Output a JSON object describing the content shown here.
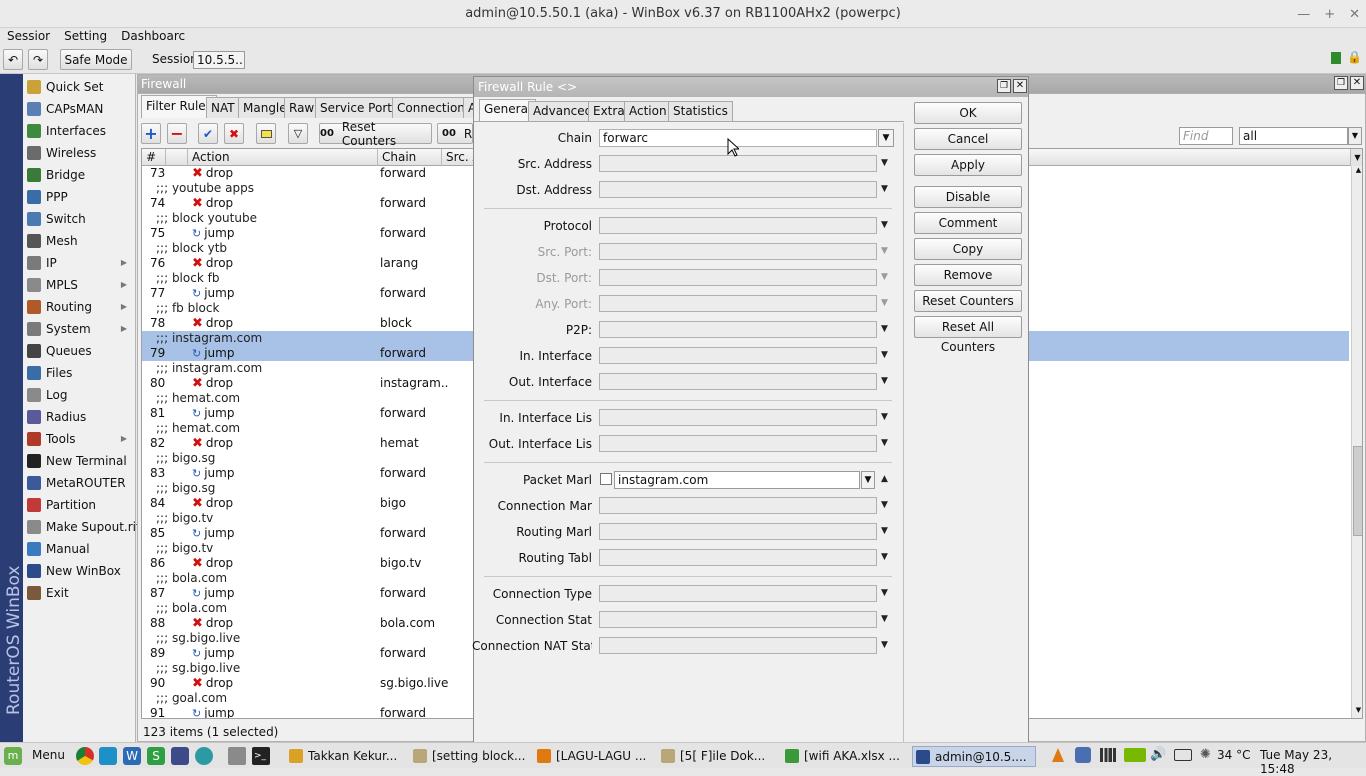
{
  "window": {
    "title": "admin@10.5.50.1 (aka) - WinBox v6.37 on RB1100AHx2 (powerpc)"
  },
  "menubar": {
    "items": [
      "Sessior",
      "Setting",
      "Dashboarc"
    ]
  },
  "toolbar": {
    "safe_mode": "Safe Mode",
    "session_label": "Session",
    "session_value": "10.5.5..."
  },
  "sidebar": {
    "vertical_text": "RouterOS WinBox",
    "items": [
      {
        "label": "Quick Set",
        "icon": "quick-set-icon",
        "color": "#c9a23a",
        "submenu": false
      },
      {
        "label": "CAPsMAN",
        "icon": "capsman-icon",
        "color": "#5b7fb5",
        "submenu": false
      },
      {
        "label": "Interfaces",
        "icon": "interfaces-icon",
        "color": "#3f8a3f",
        "submenu": false
      },
      {
        "label": "Wireless",
        "icon": "wireless-icon",
        "color": "#6b6b6b",
        "submenu": false
      },
      {
        "label": "Bridge",
        "icon": "bridge-icon",
        "color": "#3a7b3a",
        "submenu": false
      },
      {
        "label": "PPP",
        "icon": "ppp-icon",
        "color": "#3a6ca8",
        "submenu": false
      },
      {
        "label": "Switch",
        "icon": "switch-icon",
        "color": "#4a7ab0",
        "submenu": false
      },
      {
        "label": "Mesh",
        "icon": "mesh-icon",
        "color": "#555555",
        "submenu": false
      },
      {
        "label": "IP",
        "icon": "ip-icon",
        "color": "#7a7a7a",
        "submenu": true
      },
      {
        "label": "MPLS",
        "icon": "mpls-icon",
        "color": "#8a8a8a",
        "submenu": true
      },
      {
        "label": "Routing",
        "icon": "routing-icon",
        "color": "#b05a2a",
        "submenu": true
      },
      {
        "label": "System",
        "icon": "system-icon",
        "color": "#7a7a7a",
        "submenu": true
      },
      {
        "label": "Queues",
        "icon": "queues-icon",
        "color": "#444444",
        "submenu": false
      },
      {
        "label": "Files",
        "icon": "files-icon",
        "color": "#3a6ca8",
        "submenu": false
      },
      {
        "label": "Log",
        "icon": "log-icon",
        "color": "#8a8a8a",
        "submenu": false
      },
      {
        "label": "Radius",
        "icon": "radius-icon",
        "color": "#5a5a9a",
        "submenu": false
      },
      {
        "label": "Tools",
        "icon": "tools-icon",
        "color": "#b03a2a",
        "submenu": true
      },
      {
        "label": "New Terminal",
        "icon": "terminal-icon",
        "color": "#222222",
        "submenu": false
      },
      {
        "label": "MetaROUTER",
        "icon": "metarouter-icon",
        "color": "#3a5a9a",
        "submenu": false
      },
      {
        "label": "Partition",
        "icon": "partition-icon",
        "color": "#c03a3a",
        "submenu": false
      },
      {
        "label": "Make Supout.rif",
        "icon": "supout-icon",
        "color": "#8a8a8a",
        "submenu": false
      },
      {
        "label": "Manual",
        "icon": "manual-icon",
        "color": "#3a7ac0",
        "submenu": false
      },
      {
        "label": "New WinBox",
        "icon": "winbox-icon",
        "color": "#2a4a8a",
        "submenu": false
      },
      {
        "label": "Exit",
        "icon": "exit-icon",
        "color": "#7a5a3a",
        "submenu": false
      }
    ]
  },
  "firewall": {
    "title": "Firewall",
    "tabs": [
      "Filter Rules",
      "NAT",
      "Mangle",
      "Raw",
      "Service Ports",
      "Connections",
      "A"
    ],
    "reset_counters": "Reset Counters",
    "reset_all_partial": "R",
    "oo": "00",
    "find_placeholder": "Find",
    "filter_value": "all",
    "columns": [
      "#",
      "Action",
      "Chain",
      "Src. A"
    ],
    "rows": [
      {
        "type": "rule",
        "num": "73",
        "action": "drop",
        "chain": "forward",
        "selected": false
      },
      {
        "type": "comment",
        "text": ";;; youtube apps",
        "selected": false
      },
      {
        "type": "rule",
        "num": "74",
        "action": "drop",
        "chain": "forward",
        "selected": false
      },
      {
        "type": "comment",
        "text": ";;; block youtube",
        "selected": false
      },
      {
        "type": "rule",
        "num": "75",
        "action": "jump",
        "chain": "forward",
        "selected": false
      },
      {
        "type": "comment",
        "text": ";;; block ytb",
        "selected": false
      },
      {
        "type": "rule",
        "num": "76",
        "action": "drop",
        "chain": "larang",
        "selected": false
      },
      {
        "type": "comment",
        "text": ";;; block fb",
        "selected": false
      },
      {
        "type": "rule",
        "num": "77",
        "action": "jump",
        "chain": "forward",
        "selected": false
      },
      {
        "type": "comment",
        "text": ";;; fb block",
        "selected": false
      },
      {
        "type": "rule",
        "num": "78",
        "action": "drop",
        "chain": "block",
        "selected": false
      },
      {
        "type": "comment",
        "text": ";;; instagram.com",
        "selected": true
      },
      {
        "type": "rule",
        "num": "79",
        "action": "jump",
        "chain": "forward",
        "selected": true
      },
      {
        "type": "comment",
        "text": ";;; instagram.com",
        "selected": false
      },
      {
        "type": "rule",
        "num": "80",
        "action": "drop",
        "chain": "instagram..",
        "selected": false
      },
      {
        "type": "comment",
        "text": ";;; hemat.com",
        "selected": false
      },
      {
        "type": "rule",
        "num": "81",
        "action": "jump",
        "chain": "forward",
        "selected": false
      },
      {
        "type": "comment",
        "text": ";;; hemat.com",
        "selected": false
      },
      {
        "type": "rule",
        "num": "82",
        "action": "drop",
        "chain": "hemat",
        "selected": false
      },
      {
        "type": "comment",
        "text": ";;; bigo.sg",
        "selected": false
      },
      {
        "type": "rule",
        "num": "83",
        "action": "jump",
        "chain": "forward",
        "selected": false
      },
      {
        "type": "comment",
        "text": ";;; bigo.sg",
        "selected": false
      },
      {
        "type": "rule",
        "num": "84",
        "action": "drop",
        "chain": "bigo",
        "selected": false
      },
      {
        "type": "comment",
        "text": ";;; bigo.tv",
        "selected": false
      },
      {
        "type": "rule",
        "num": "85",
        "action": "jump",
        "chain": "forward",
        "selected": false
      },
      {
        "type": "comment",
        "text": ";;; bigo.tv",
        "selected": false
      },
      {
        "type": "rule",
        "num": "86",
        "action": "drop",
        "chain": "bigo.tv",
        "selected": false
      },
      {
        "type": "comment",
        "text": ";;; bola.com",
        "selected": false
      },
      {
        "type": "rule",
        "num": "87",
        "action": "jump",
        "chain": "forward",
        "selected": false
      },
      {
        "type": "comment",
        "text": ";;; bola.com",
        "selected": false
      },
      {
        "type": "rule",
        "num": "88",
        "action": "drop",
        "chain": "bola.com",
        "selected": false
      },
      {
        "type": "comment",
        "text": ";;; sg.bigo.live",
        "selected": false
      },
      {
        "type": "rule",
        "num": "89",
        "action": "jump",
        "chain": "forward",
        "selected": false
      },
      {
        "type": "comment",
        "text": ";;; sg.bigo.live",
        "selected": false
      },
      {
        "type": "rule",
        "num": "90",
        "action": "drop",
        "chain": "sg.bigo.live",
        "selected": false
      },
      {
        "type": "comment",
        "text": ";;; goal.com",
        "selected": false
      },
      {
        "type": "rule",
        "num": "91",
        "action": "jump",
        "chain": "forward",
        "selected": false
      }
    ],
    "status": "123 items (1 selected)"
  },
  "dialog": {
    "title": "Firewall Rule <>",
    "tabs": [
      "General",
      "Advanced",
      "Extra",
      "Action",
      "Statistics"
    ],
    "fields": {
      "chain": {
        "label": "Chain",
        "value": "forwarc"
      },
      "src_address": {
        "label": "Src. Address"
      },
      "dst_address": {
        "label": "Dst. Address"
      },
      "protocol": {
        "label": "Protocol"
      },
      "src_port": {
        "label": "Src. Port:"
      },
      "dst_port": {
        "label": "Dst. Port:"
      },
      "any_port": {
        "label": "Any. Port:"
      },
      "p2p": {
        "label": "P2P:"
      },
      "in_interface": {
        "label": "In. Interface"
      },
      "out_interface": {
        "label": "Out. Interface"
      },
      "in_interface_list": {
        "label": "In. Interface Lis"
      },
      "out_interface_list": {
        "label": "Out. Interface Lis"
      },
      "packet_mark": {
        "label": "Packet Marl",
        "value": "instagram.com"
      },
      "connection_mark": {
        "label": "Connection Mar"
      },
      "routing_mark": {
        "label": "Routing Marl"
      },
      "routing_table": {
        "label": "Routing Tabl"
      },
      "connection_type": {
        "label": "Connection Type"
      },
      "connection_state": {
        "label": "Connection Stat"
      },
      "connection_nat_state": {
        "label": "Connection NAT Stat"
      }
    },
    "buttons": [
      "OK",
      "Cancel",
      "Apply",
      "Disable",
      "Comment",
      "Copy",
      "Remove",
      "Reset Counters",
      "Reset All Counters"
    ]
  },
  "taskbar": {
    "menu": "Menu",
    "tasks": [
      {
        "label": "Takkan Kekur...",
        "icon": "chrome-icon",
        "color": "#d9a227",
        "active": false
      },
      {
        "label": "[setting block...",
        "icon": "folder-icon",
        "color": "#b8a878",
        "active": false
      },
      {
        "label": "[LAGU-LAGU ...",
        "icon": "vlc-icon",
        "color": "#e07a10",
        "active": false
      },
      {
        "label": "[5[ F]ile Dok...",
        "icon": "folder-icon",
        "color": "#b8a878",
        "active": false
      },
      {
        "label": "[wifi AKA.xlsx ...",
        "icon": "spreadsheet-icon",
        "color": "#3a9a3a",
        "active": false
      },
      {
        "label": "admin@10.5....",
        "icon": "winbox-icon",
        "color": "#2a4a8a",
        "active": true
      }
    ],
    "temperature": "34 °C",
    "clock": "Tue May 23, 15:48"
  }
}
